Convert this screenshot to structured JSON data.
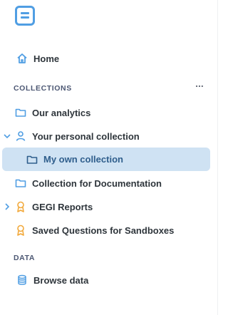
{
  "logo": {
    "icon": "metabase-logo-icon",
    "color": "#509ee3"
  },
  "nav": {
    "home_label": "Home"
  },
  "collections": {
    "section_label": "COLLECTIONS",
    "more_label": "...",
    "items": [
      {
        "label": "Our analytics",
        "icon": "folder-icon"
      },
      {
        "label": "Your personal collection",
        "icon": "person-icon",
        "expanded": true
      },
      {
        "label": "My own collection",
        "icon": "folder-icon",
        "selected": true
      },
      {
        "label": "Collection for Documentation",
        "icon": "folder-icon"
      },
      {
        "label": "GEGI Reports",
        "icon": "badge-icon",
        "expandable": true
      },
      {
        "label": "Saved Questions for Sandboxes",
        "icon": "badge-icon"
      }
    ]
  },
  "data_section": {
    "section_label": "DATA",
    "browse_label": "Browse data",
    "icon": "database-icon"
  },
  "colors": {
    "accent": "#509ee3",
    "selected_bg": "#cfe2f3",
    "badge": "#f2a93b"
  }
}
